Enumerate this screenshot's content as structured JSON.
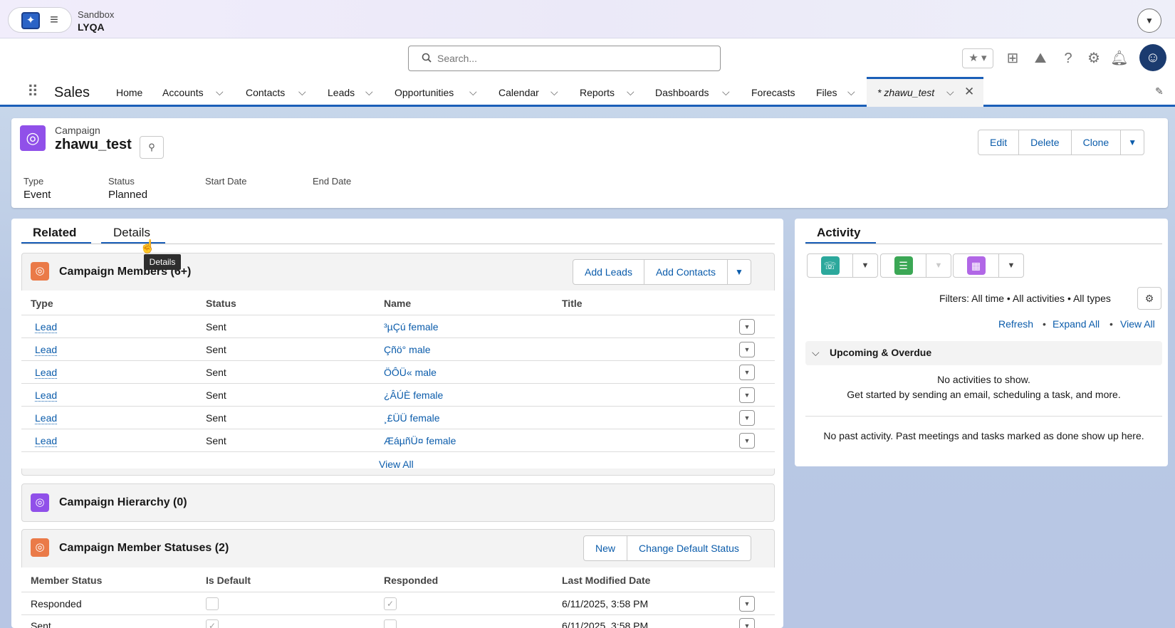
{
  "org": {
    "type": "Sandbox",
    "name": "LYQA"
  },
  "search": {
    "placeholder": "Search..."
  },
  "nav": {
    "app_title": "Sales",
    "items": [
      "Home",
      "Accounts",
      "Contacts",
      "Leads",
      "Opportunities",
      "Calendar",
      "Reports",
      "Dashboards",
      "Forecasts",
      "Files"
    ],
    "active_tab": "* zhawu_test"
  },
  "record": {
    "object_type": "Campaign",
    "name": "zhawu_test",
    "buttons": [
      "Edit",
      "Delete",
      "Clone"
    ],
    "fields": [
      {
        "label": "Type",
        "value": "Event"
      },
      {
        "label": "Status",
        "value": "Planned"
      },
      {
        "label": "Start Date",
        "value": ""
      },
      {
        "label": "End Date",
        "value": ""
      }
    ]
  },
  "tabs": {
    "related": "Related",
    "details": "Details",
    "tooltip": "Details"
  },
  "members": {
    "title": "Campaign Members (6+)",
    "buttons": [
      "Add Leads",
      "Add Contacts"
    ],
    "headers": [
      "Type",
      "Status",
      "Name",
      "Title"
    ],
    "rows": [
      {
        "type": "Lead",
        "status": "Sent",
        "name": "³µÇú female",
        "title": ""
      },
      {
        "type": "Lead",
        "status": "Sent",
        "name": "Çñö° male",
        "title": ""
      },
      {
        "type": "Lead",
        "status": "Sent",
        "name": "ÖÔÜ« male",
        "title": ""
      },
      {
        "type": "Lead",
        "status": "Sent",
        "name": "¿ÂÚÈ female",
        "title": ""
      },
      {
        "type": "Lead",
        "status": "Sent",
        "name": "¸£ÜÜ female",
        "title": ""
      },
      {
        "type": "Lead",
        "status": "Sent",
        "name": "ÆáµñÜ¤ female",
        "title": ""
      }
    ],
    "view_all": "View All"
  },
  "hierarchy": {
    "title": "Campaign Hierarchy (0)"
  },
  "statuses": {
    "title": "Campaign Member Statuses (2)",
    "buttons": [
      "New",
      "Change Default Status"
    ],
    "headers": [
      "Member Status",
      "Is Default",
      "Responded",
      "Last Modified Date"
    ],
    "rows": [
      {
        "status": "Responded",
        "is_default": false,
        "responded": true,
        "modified": "6/11/2025, 3:58 PM"
      },
      {
        "status": "Sent",
        "is_default": true,
        "responded": false,
        "modified": "6/11/2025, 3:58 PM"
      }
    ]
  },
  "activity": {
    "title": "Activity",
    "filters": "Filters: All time • All activities • All types",
    "links": [
      "Refresh",
      "Expand All",
      "View All"
    ],
    "upcoming_title": "Upcoming & Overdue",
    "no_activities": "No activities to show.",
    "get_started": "Get started by sending an email, scheduling a task, and more.",
    "no_past": "No past activity. Past meetings and tasks marked as done show up here."
  },
  "colors": {
    "brand": "#0b5cab",
    "campaign": "#9050e9",
    "member": "#ea7a48",
    "call": "#2ca89c",
    "task": "#3ba755",
    "event": "#b167e6"
  }
}
